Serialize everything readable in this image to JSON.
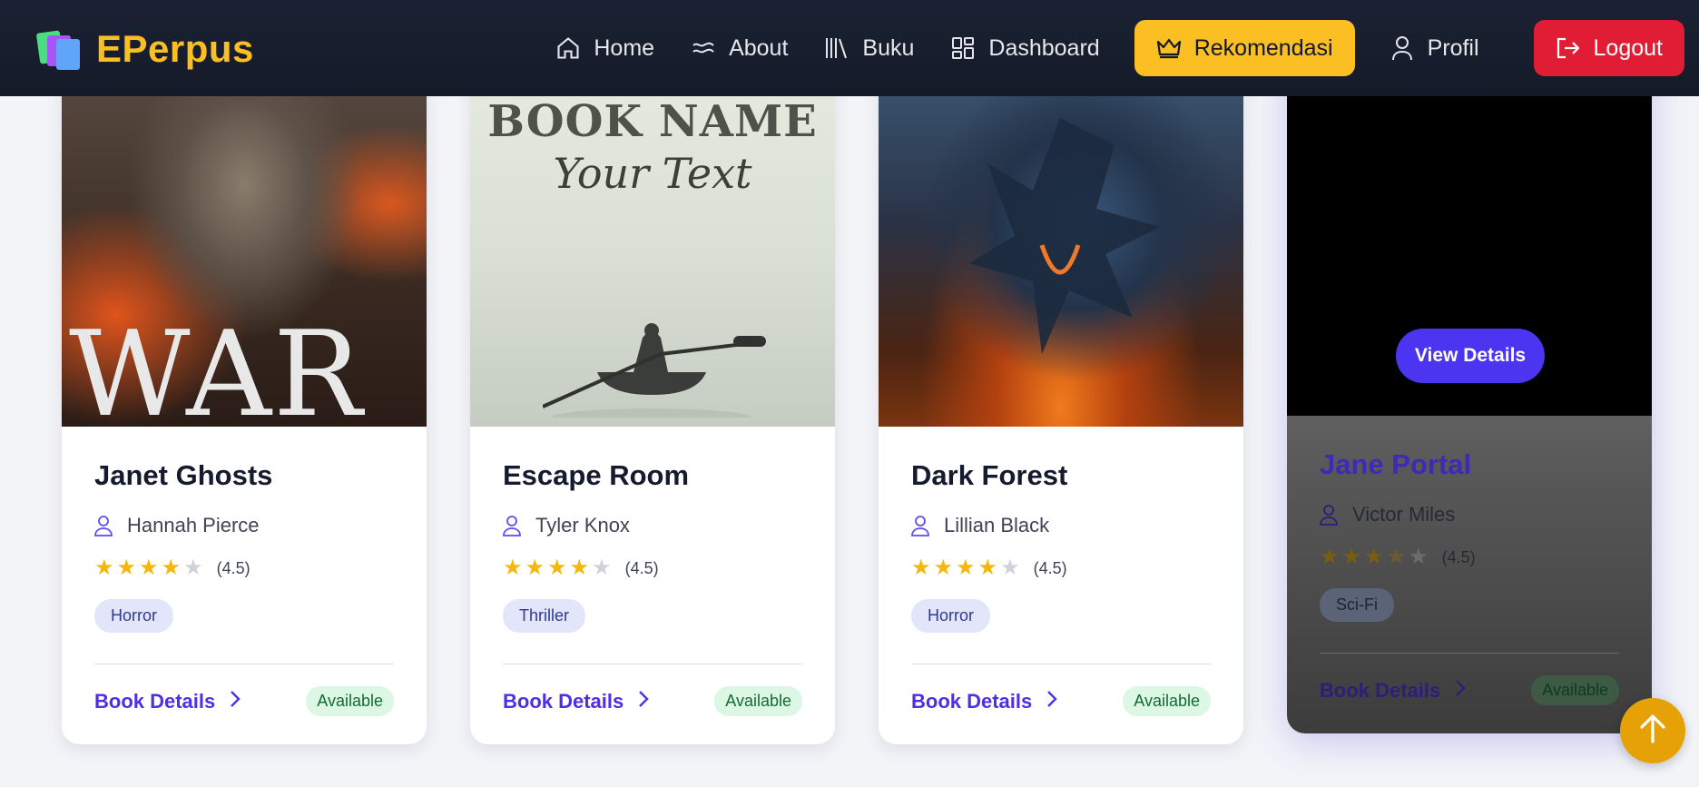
{
  "brand": {
    "name": "EPerpus"
  },
  "nav": {
    "items": [
      {
        "label": "Home",
        "icon": "home-icon"
      },
      {
        "label": "About",
        "icon": "wave-icon"
      },
      {
        "label": "Buku",
        "icon": "library-icon"
      },
      {
        "label": "Dashboard",
        "icon": "grid-icon"
      },
      {
        "label": "Rekomendasi",
        "icon": "crown-icon",
        "active": true
      },
      {
        "label": "Profil",
        "icon": "user-icon"
      },
      {
        "label": "Logout",
        "icon": "logout-icon"
      }
    ]
  },
  "books": [
    {
      "title": "Janet Ghosts",
      "author": "Hannah Pierce",
      "rating": "(4.5)",
      "stars": 4,
      "genre": "Horror",
      "details_label": "Book Details",
      "status": "Available",
      "cover_text": "WAR"
    },
    {
      "title": "Escape Room",
      "author": "Tyler Knox",
      "rating": "(4.5)",
      "stars": 4,
      "genre": "Thriller",
      "details_label": "Book Details",
      "status": "Available",
      "cover_text": "BOOK NAME",
      "cover_subtext": "Your Text"
    },
    {
      "title": "Dark Forest",
      "author": "Lillian Black",
      "rating": "(4.5)",
      "stars": 4,
      "genre": "Horror",
      "details_label": "Book Details",
      "status": "Available"
    },
    {
      "title": "Jane Portal",
      "author": "Victor Miles",
      "rating": "(4.5)",
      "stars": 3.5,
      "genre": "Sci-Fi",
      "details_label": "Book Details",
      "status": "Available",
      "view_label": "View Details"
    }
  ],
  "colors": {
    "accent": "#fbbf24",
    "primary": "#4f2ee6",
    "logout": "#e11d36",
    "star": "#f6b70c"
  }
}
